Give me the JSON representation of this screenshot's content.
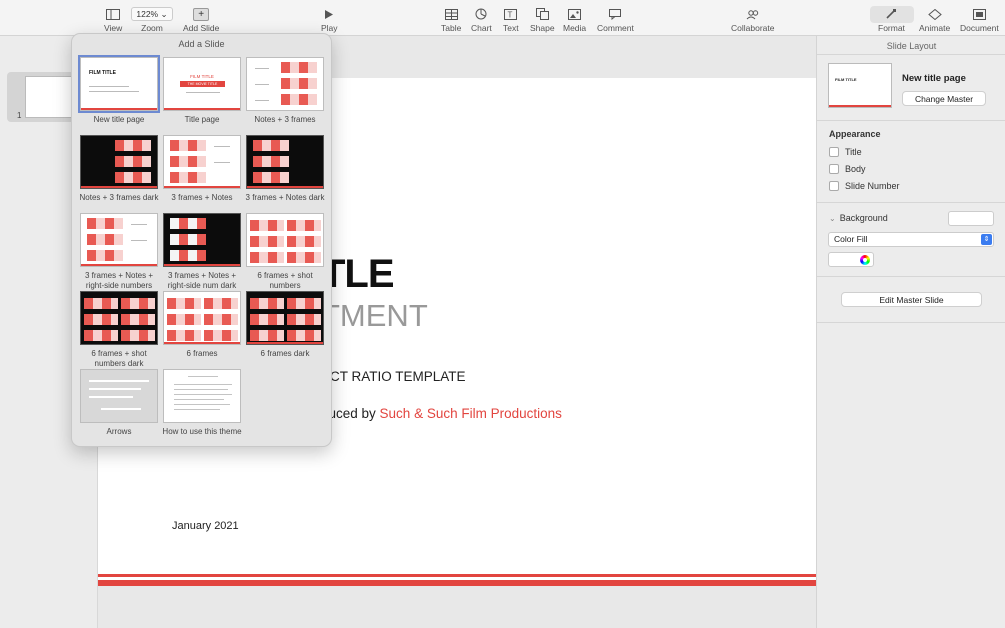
{
  "toolbar": {
    "view": "View",
    "zoom_value": "122% ⌄",
    "zoom": "Zoom",
    "add_slide": "Add Slide",
    "play": "Play",
    "table": "Table",
    "chart": "Chart",
    "text": "Text",
    "shape": "Shape",
    "media": "Media",
    "comment": "Comment",
    "collaborate": "Collaborate",
    "format": "Format",
    "animate": "Animate",
    "document": "Document"
  },
  "navigator": {
    "slide_number": "1"
  },
  "slide": {
    "title_fragment": "TLE",
    "subtitle_fragment": "TMENT",
    "aspect_fragment": "ECT RATIO TEMPLATE",
    "produced_prefix": "duced by ",
    "studio": "Such & Such Film Productions",
    "date": "January 2021"
  },
  "popover": {
    "title": "Add a Slide",
    "layouts": [
      {
        "label": "New title page"
      },
      {
        "label": "Title page"
      },
      {
        "label": "Notes + 3 frames"
      },
      {
        "label": "Notes + 3 frames dark"
      },
      {
        "label": "3 frames + Notes"
      },
      {
        "label": "3 frames + Notes dark"
      },
      {
        "label": "3 frames + Notes + right-side numbers"
      },
      {
        "label": "3 frames + Notes + right-side num dark"
      },
      {
        "label": "6 frames + shot numbers"
      },
      {
        "label": "6 frames + shot numbers dark"
      },
      {
        "label": "6 frames"
      },
      {
        "label": "6 frames dark"
      },
      {
        "label": "Arrows"
      },
      {
        "label": "How to use this theme"
      }
    ],
    "thumb_text": {
      "film_title": "FILM TITLE",
      "movie_title": "THE MOVIE TITLE"
    }
  },
  "inspector": {
    "title": "Slide Layout",
    "master_name": "New title page",
    "change_master": "Change Master",
    "appearance": "Appearance",
    "checkbox_title": "Title",
    "checkbox_body": "Body",
    "checkbox_slide_number": "Slide Number",
    "background": "Background",
    "fill_type": "Color Fill",
    "edit_master": "Edit Master Slide"
  },
  "colors": {
    "accent": "#e2453f",
    "selection": "#3a7cf0"
  }
}
